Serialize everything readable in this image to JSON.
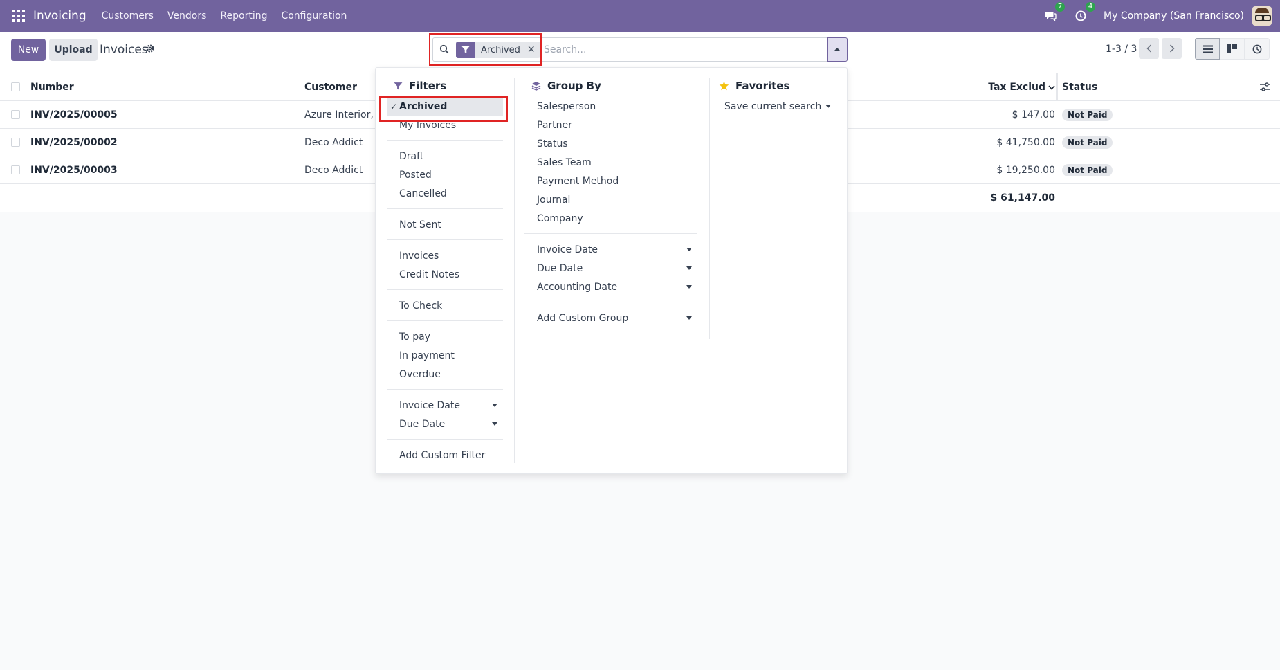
{
  "navbar": {
    "brand": "Invoicing",
    "menu": [
      "Customers",
      "Vendors",
      "Reporting",
      "Configuration"
    ],
    "messages_count": "7",
    "activities_count": "4",
    "company": "My Company (San Francisco)"
  },
  "control": {
    "new_label": "New",
    "upload_label": "Upload",
    "title": "Invoices",
    "pager": "1-3 / 3"
  },
  "search": {
    "facet_label": "Archived",
    "placeholder": "Search..."
  },
  "table": {
    "headers": {
      "number": "Number",
      "customer": "Customer",
      "tax": "Tax Exclud",
      "status": "Status"
    },
    "rows": [
      {
        "number": "INV/2025/00005",
        "customer": "Azure Interior, C",
        "tax": "$ 147.00",
        "status": "Not Paid"
      },
      {
        "number": "INV/2025/00002",
        "customer": "Deco Addict",
        "tax": "$ 41,750.00",
        "status": "Not Paid"
      },
      {
        "number": "INV/2025/00003",
        "customer": "Deco Addict",
        "tax": "$ 19,250.00",
        "status": "Not Paid"
      }
    ],
    "total": "$ 61,147.00"
  },
  "dropdown": {
    "filters": {
      "title": "Filters",
      "groups": [
        [
          "Archived",
          "My Invoices"
        ],
        [
          "Draft",
          "Posted",
          "Cancelled"
        ],
        [
          "Not Sent"
        ],
        [
          "Invoices",
          "Credit Notes"
        ],
        [
          "To Check"
        ],
        [
          "To pay",
          "In payment",
          "Overdue"
        ],
        [
          "Invoice Date",
          "Due Date"
        ],
        [
          "Add Custom Filter"
        ]
      ]
    },
    "group_by": {
      "title": "Group By",
      "groups": [
        [
          "Salesperson",
          "Partner",
          "Status",
          "Sales Team",
          "Payment Method",
          "Journal",
          "Company"
        ],
        [
          "Invoice Date",
          "Due Date",
          "Accounting Date"
        ],
        [
          "Add Custom Group"
        ]
      ]
    },
    "favorites": {
      "title": "Favorites",
      "save_label": "Save current search"
    }
  },
  "colors": {
    "brand": "#71639e",
    "highlight": "#e02424",
    "badge": "#2ea44f"
  }
}
